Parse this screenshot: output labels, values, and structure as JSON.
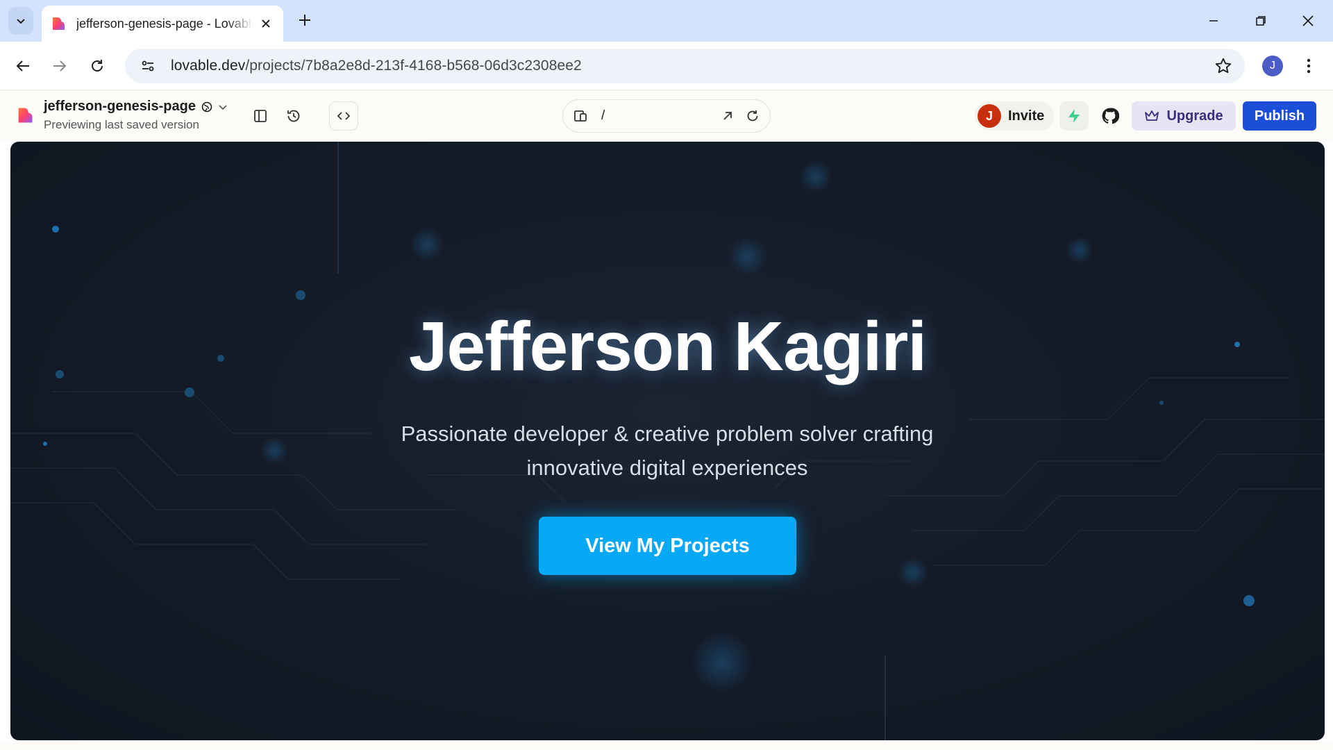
{
  "browser": {
    "tab_title": "jefferson-genesis-page - Lovable",
    "url_host": "lovable.dev",
    "url_path": "/projects/7b8a2e8d-213f-4168-b568-06d3c2308ee2",
    "profile_initial": "J"
  },
  "appbar": {
    "project_name": "jefferson-genesis-page",
    "subtitle": "Previewing last saved version",
    "route": "/",
    "invite_avatar": "J",
    "invite_label": "Invite",
    "upgrade_label": "Upgrade",
    "publish_label": "Publish"
  },
  "preview": {
    "title": "Jefferson Kagiri",
    "subtitle": "Passionate developer & creative problem solver crafting innovative digital experiences",
    "cta_label": "View My Projects"
  },
  "colors": {
    "tabstrip": "#d3e3fd",
    "publish": "#1d4ed8",
    "upgrade_bg": "#e7e4f6",
    "preview_bg": "#151c28",
    "cta": "#07a8f5",
    "invite_avatar": "#c72f0f"
  },
  "icons": [
    "tab-search-icon",
    "lovable-logo-icon",
    "close-icon",
    "plus-icon",
    "minimize-icon",
    "restore-icon",
    "window-close-icon",
    "back-icon",
    "forward-icon",
    "reload-icon",
    "site-info-icon",
    "star-icon",
    "kebab-icon",
    "globe-icon",
    "chevron-down-icon",
    "sidebar-icon",
    "history-icon",
    "code-icon",
    "device-icon",
    "external-link-icon",
    "refresh-icon",
    "supabase-icon",
    "github-icon",
    "crown-icon"
  ]
}
